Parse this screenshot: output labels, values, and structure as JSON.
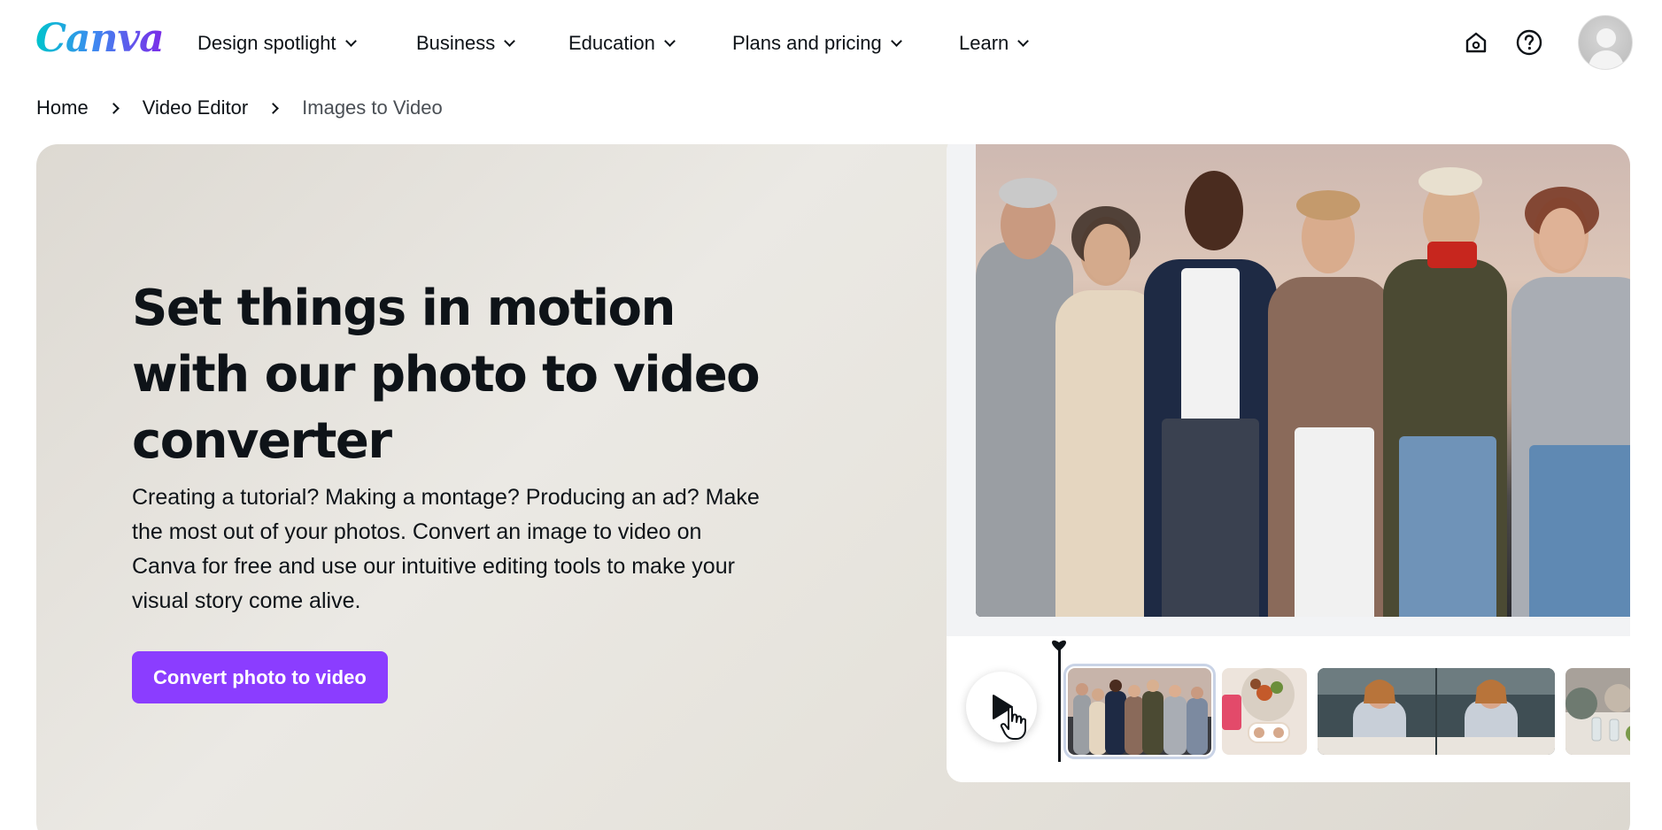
{
  "brand": {
    "logo_text": "Canva"
  },
  "nav": {
    "items": [
      {
        "label": "Design spotlight"
      },
      {
        "label": "Business"
      },
      {
        "label": "Education"
      },
      {
        "label": "Plans and pricing"
      },
      {
        "label": "Learn"
      }
    ],
    "icons": [
      "home-icon",
      "help-icon"
    ],
    "avatar": "user-avatar"
  },
  "breadcrumb": {
    "items": [
      {
        "label": "Home"
      },
      {
        "label": "Video Editor"
      },
      {
        "label": "Images to Video"
      }
    ]
  },
  "hero": {
    "headline": "Set things in motion with our photo to video converter",
    "description": "Creating a tutorial? Making a montage? Producing an ad? Make the most out of your photos. Convert an image to video on Canva for free and use our intuitive editing tools to make your visual story come alive.",
    "cta_label": "Convert photo to video"
  },
  "editor_preview": {
    "play_icon": "play-icon",
    "clips": [
      "group-photo-clip",
      "food-clip",
      "dinner-clip",
      "table-clip"
    ]
  },
  "colors": {
    "accent": "#8b3dff",
    "text": "#0e1318",
    "hero_bg": "#e6e3dc"
  }
}
